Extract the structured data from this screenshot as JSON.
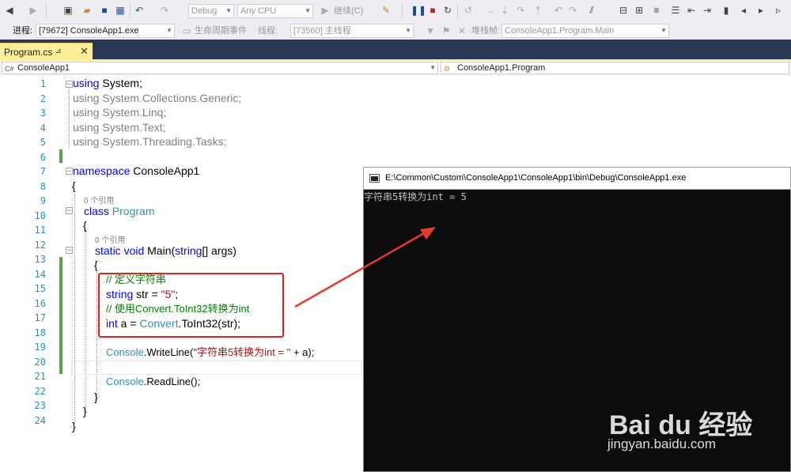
{
  "toolbar": {
    "config": "Debug",
    "platform": "Any CPU",
    "continue": "继续(C)"
  },
  "debugbar": {
    "process_label": "进程:",
    "process_value": "[79672] ConsoleApp1.exe",
    "lifecycle": "生命周期事件",
    "thread_label": "线程:",
    "thread_value": "[73560] 主线程",
    "stack_label": "堆栈帧:",
    "stack_value": "ConsoleApp1.Program.Main"
  },
  "tab": {
    "label": "Program.cs"
  },
  "navbar": {
    "project": "ConsoleApp1",
    "type": "ConsoleApp1.Program"
  },
  "editor": {
    "line_numbers": [
      "1",
      "2",
      "3",
      "4",
      "5",
      "6",
      "7",
      "8",
      "9",
      "10",
      "11",
      "12",
      "13",
      "14",
      "15",
      "16",
      "17",
      "18",
      "19",
      "20",
      "21",
      "22",
      "23",
      "24"
    ],
    "refs_text": "0 个引用",
    "lines": {
      "l1_kw": "using",
      "l1_rest": " System;",
      "l2": "using System.Collections.Generic;",
      "l3": "using System.Linq;",
      "l4": "using System.Text;",
      "l5": "using System.Threading.Tasks;",
      "l7_kw": "namespace",
      "l7_rest": " ConsoleApp1",
      "l8": "{",
      "l9_kw": "class",
      "l9_ty": " Program",
      "l10": "{",
      "l11_kw": "static void",
      "l11_a": " Main(",
      "l11_kw2": "string",
      "l11_b": "[] args)",
      "l12": "{",
      "l13": "// 定义字符串",
      "l14_kw": "string",
      "l14_a": " str = ",
      "l14_str": "\"5\"",
      "l14_b": ";",
      "l15": "// 使用Convert.ToInt32转换为int",
      "l16_kw": "int",
      "l16_a": " a = ",
      "l16_ty": "Convert",
      "l16_b": ".ToInt32(str);",
      "l18_ty": "Console",
      "l18_a": ".WriteLine(",
      "l18_str": "\"字符串5转换为int = \"",
      "l18_b": " + a);",
      "l20_ty": "Console",
      "l20_a": ".ReadLine();",
      "l21": "}",
      "l22": "}",
      "l23": "}"
    }
  },
  "console": {
    "title": "E:\\Common\\Custom\\ConsoleApp1\\ConsoleApp1\\bin\\Debug\\ConsoleApp1.exe",
    "output": "字符串5转换为int = 5"
  },
  "watermark": {
    "brand": "Bai du 经验",
    "url": "jingyan.baidu.com"
  },
  "colors": {
    "keyword": "#0000ff",
    "type": "#2b91af",
    "string": "#a31515",
    "comment": "#008000",
    "highlight_box": "#e02020",
    "arrow": "#e53a2a"
  }
}
